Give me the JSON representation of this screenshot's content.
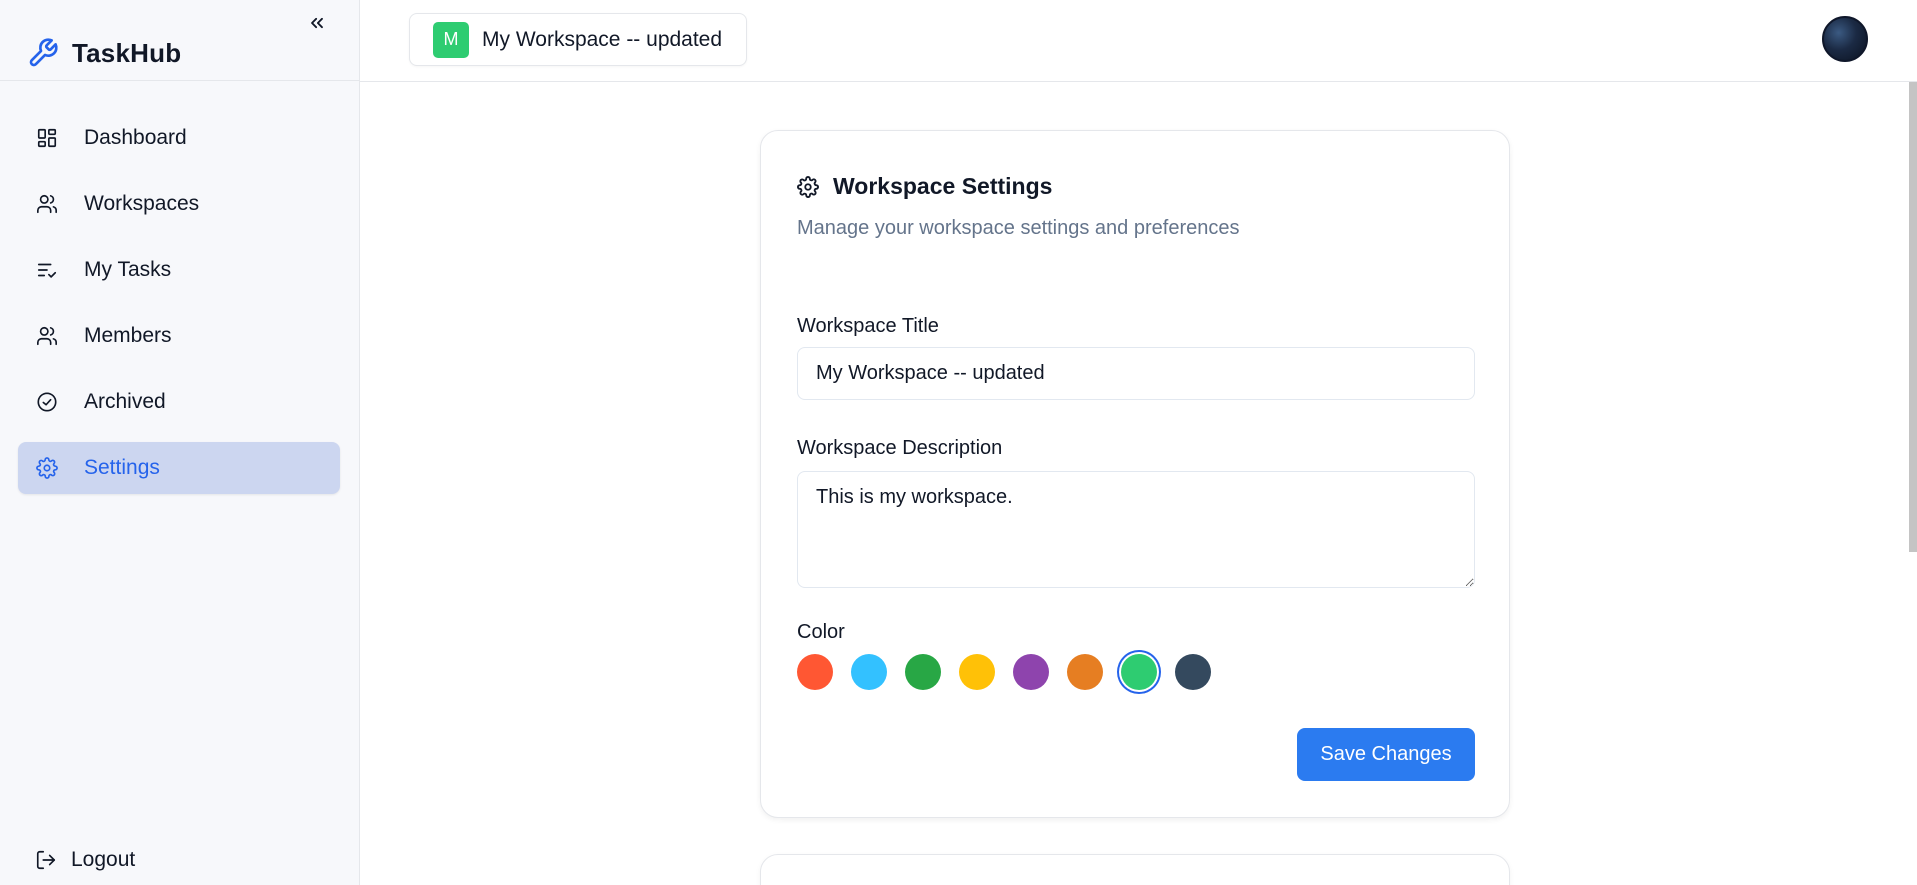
{
  "app": {
    "name": "TaskHub",
    "logo_icon": "wrench-icon",
    "collapse_icon": "chevrons-left-icon"
  },
  "sidebar": {
    "items": [
      {
        "label": "Dashboard",
        "icon": "layout-dashboard-icon",
        "active": false
      },
      {
        "label": "Workspaces",
        "icon": "users-icon",
        "active": false
      },
      {
        "label": "My Tasks",
        "icon": "list-check-icon",
        "active": false
      },
      {
        "label": "Members",
        "icon": "users-icon",
        "active": false
      },
      {
        "label": "Archived",
        "icon": "check-circle-icon",
        "active": false
      },
      {
        "label": "Settings",
        "icon": "gear-icon",
        "active": true
      }
    ],
    "logout_label": "Logout"
  },
  "topbar": {
    "workspace": {
      "initial": "M",
      "name": "My Workspace -- updated",
      "color": "#2ecc71"
    }
  },
  "settings": {
    "title": "Workspace Settings",
    "subtitle": "Manage your workspace settings and preferences",
    "title_label": "Workspace Title",
    "title_value": "My Workspace -- updated",
    "description_label": "Workspace Description",
    "description_value": "This is my workspace.",
    "color_label": "Color",
    "colors": [
      "#ff5733",
      "#33c1ff",
      "#28a745",
      "#ffc107",
      "#8e44ad",
      "#e67e22",
      "#2ecc71",
      "#34495e"
    ],
    "selected_color": "#2ecc71",
    "save_label": "Save Changes"
  },
  "theme": {
    "accent": "#2563eb",
    "button": "#2b7bf0",
    "active_nav_bg": "#ccd6f0"
  }
}
